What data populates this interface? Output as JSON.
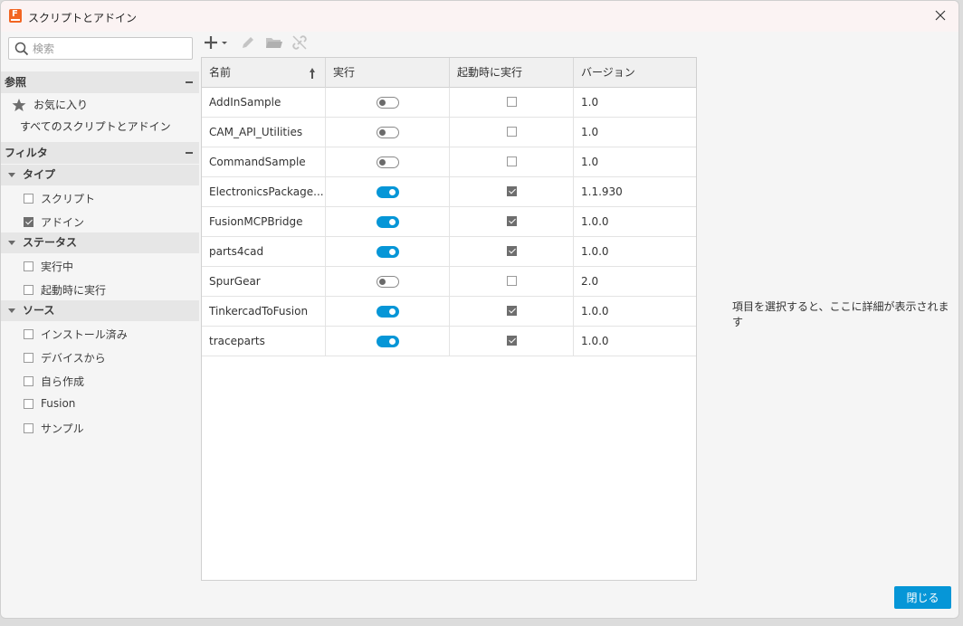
{
  "window": {
    "title": "スクリプトとアドイン"
  },
  "search": {
    "placeholder": "検索"
  },
  "sidebar": {
    "reference_header": "参照",
    "favorites": "お気に入り",
    "all_scripts": "すべてのスクリプトとアドイン",
    "filter_header": "フィルタ",
    "type": {
      "header": "タイプ",
      "items": [
        {
          "label": "スクリプト",
          "checked": false
        },
        {
          "label": "アドイン",
          "checked": true
        }
      ]
    },
    "status": {
      "header": "ステータス",
      "items": [
        {
          "label": "実行中",
          "checked": false
        },
        {
          "label": "起動時に実行",
          "checked": false
        }
      ]
    },
    "source": {
      "header": "ソース",
      "items": [
        {
          "label": "インストール済み",
          "checked": false
        },
        {
          "label": "デバイスから",
          "checked": false
        },
        {
          "label": "自ら作成",
          "checked": false
        },
        {
          "label": "Fusion",
          "checked": false
        },
        {
          "label": "サンプル",
          "checked": false
        }
      ]
    }
  },
  "table": {
    "columns": [
      "名前",
      "実行",
      "起動時に実行",
      "バージョン"
    ],
    "rows": [
      {
        "name": "AddInSample",
        "run": false,
        "startup": false,
        "version": "1.0"
      },
      {
        "name": "CAM_API_Utilities",
        "run": false,
        "startup": false,
        "version": "1.0"
      },
      {
        "name": "CommandSample",
        "run": false,
        "startup": false,
        "version": "1.0"
      },
      {
        "name": "ElectronicsPackage...",
        "run": true,
        "startup": true,
        "version": "1.1.930"
      },
      {
        "name": "FusionMCPBridge",
        "run": true,
        "startup": true,
        "version": "1.0.0"
      },
      {
        "name": "parts4cad",
        "run": true,
        "startup": true,
        "version": "1.0.0"
      },
      {
        "name": "SpurGear",
        "run": false,
        "startup": false,
        "version": "2.0"
      },
      {
        "name": "TinkercadToFusion",
        "run": true,
        "startup": true,
        "version": "1.0.0"
      },
      {
        "name": "traceparts",
        "run": true,
        "startup": true,
        "version": "1.0.0"
      }
    ]
  },
  "detail": {
    "placeholder_text": "項目を選択すると、ここに詳細が表示されます"
  },
  "footer": {
    "close_label": "閉じる"
  },
  "colors": {
    "accent": "#0696d7",
    "brand": "#f26522"
  }
}
